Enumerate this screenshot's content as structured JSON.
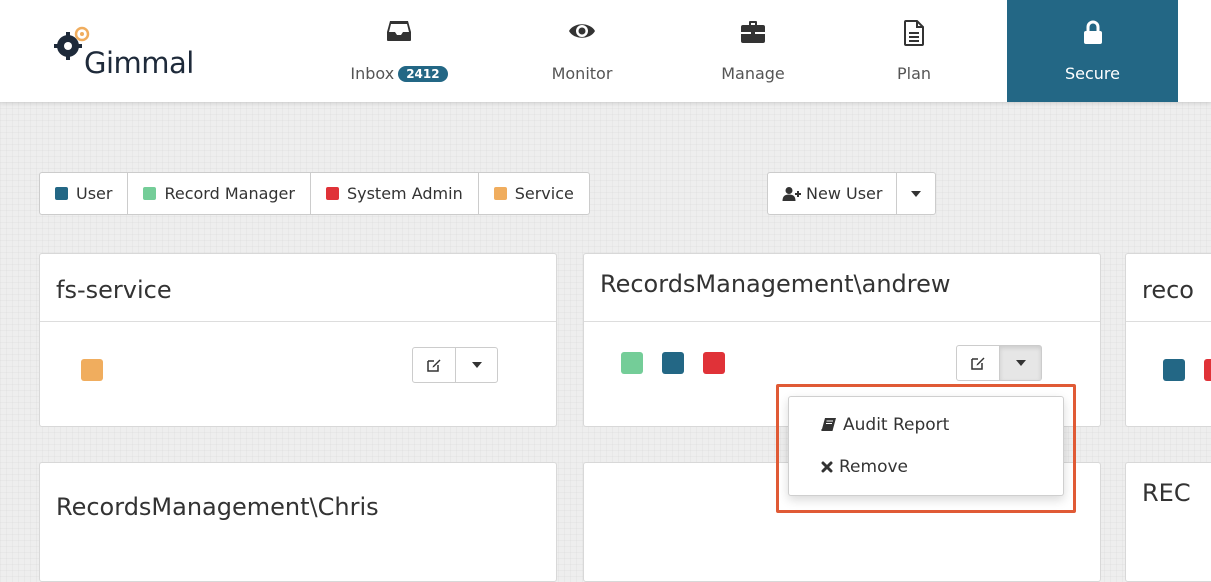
{
  "brand": {
    "name": "Gimmal"
  },
  "nav": {
    "inbox": {
      "label": "Inbox",
      "badge": "2412"
    },
    "monitor": {
      "label": "Monitor"
    },
    "manage": {
      "label": "Manage"
    },
    "plan": {
      "label": "Plan"
    },
    "secure": {
      "label": "Secure"
    }
  },
  "legend": {
    "user": {
      "label": "User",
      "color": "#236785"
    },
    "record_manager": {
      "label": "Record Manager",
      "color": "#74cd98"
    },
    "system_admin": {
      "label": "System Admin",
      "color": "#e03238"
    },
    "service": {
      "label": "Service",
      "color": "#f0ad5e"
    }
  },
  "toolbar": {
    "new_user_label": "New User"
  },
  "cards": {
    "c1": {
      "title": "fs-service",
      "roles": [
        "service"
      ]
    },
    "c2": {
      "title": "RecordsManagement\\andrew",
      "roles": [
        "record_manager",
        "user",
        "system_admin"
      ]
    },
    "c3": {
      "title": "reco",
      "roles": [
        "user",
        "system_admin"
      ]
    },
    "c4": {
      "title": "RecordsManagement\\Chris"
    },
    "c5": {
      "title": ""
    },
    "c6": {
      "title": "REC"
    }
  },
  "dropdown": {
    "audit_report": "Audit Report",
    "remove": "Remove"
  }
}
